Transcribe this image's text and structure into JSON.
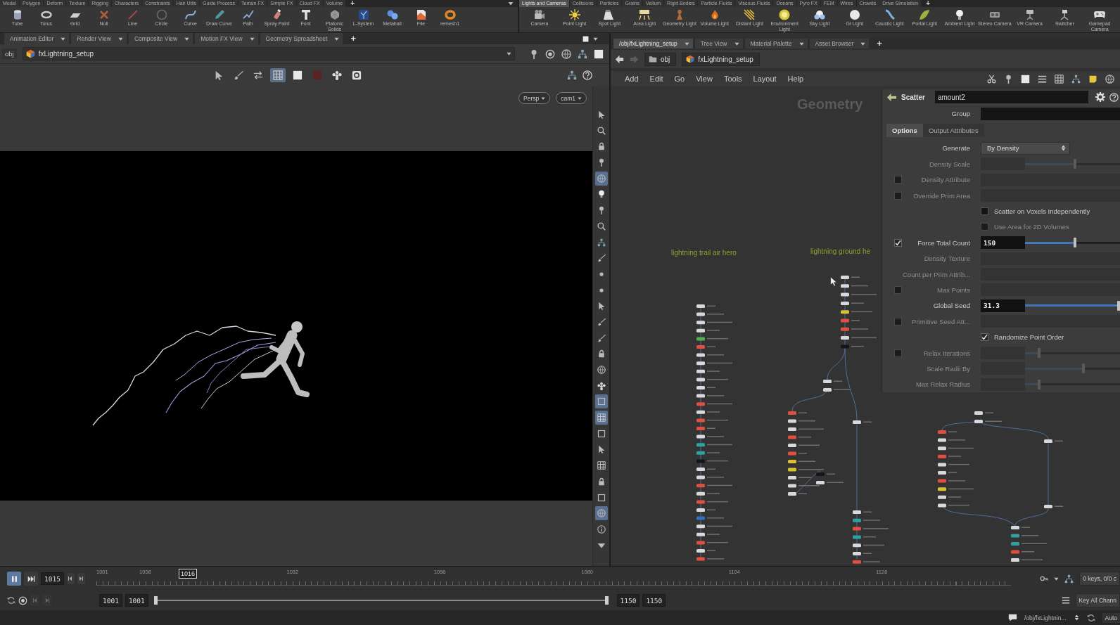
{
  "shelf": {
    "left": {
      "tabs": [
        {
          "label": "Model",
          "selected": false
        },
        {
          "label": "Polygon",
          "selected": false
        },
        {
          "label": "Deform",
          "selected": false
        },
        {
          "label": "Texture",
          "selected": false
        },
        {
          "label": "Rigging",
          "selected": false
        },
        {
          "label": "Characters",
          "selected": false
        },
        {
          "label": "Constraints",
          "selected": false
        },
        {
          "label": "Hair Utils",
          "selected": false
        },
        {
          "label": "Guide Process",
          "selected": false
        },
        {
          "label": "Terrain FX",
          "selected": false
        },
        {
          "label": "Simple FX",
          "selected": false
        },
        {
          "label": "Cloud FX",
          "selected": false
        },
        {
          "label": "Volume",
          "selected": false
        }
      ],
      "add": "+",
      "tools": [
        "Tube",
        "Torus",
        "Grid",
        "Null",
        "Line",
        "Circle",
        "Curve",
        "Draw Curve",
        "Path",
        "Spray Paint",
        "Font",
        "Platonic Solids",
        "L-System",
        "Metaball",
        "File",
        "remesh1"
      ]
    },
    "right": {
      "tabs": [
        {
          "label": "Lights and Cameras",
          "selected": true
        },
        {
          "label": "Collisions",
          "selected": false
        },
        {
          "label": "Particles",
          "selected": false
        },
        {
          "label": "Grains",
          "selected": false
        },
        {
          "label": "Vellum",
          "selected": false
        },
        {
          "label": "Rigid Bodies",
          "selected": false
        },
        {
          "label": "Particle Fluids",
          "selected": false
        },
        {
          "label": "Viscous Fluids",
          "selected": false
        },
        {
          "label": "Oceans",
          "selected": false
        },
        {
          "label": "Pyro FX",
          "selected": false
        },
        {
          "label": "FEM",
          "selected": false
        },
        {
          "label": "Wires",
          "selected": false
        },
        {
          "label": "Crowds",
          "selected": false
        },
        {
          "label": "Drive Simulation",
          "selected": false
        }
      ],
      "add": "+",
      "tools": [
        "Camera",
        "Point Light",
        "Spot Light",
        "Area Light",
        "Geometry Light",
        "Volume Light",
        "Distant Light",
        "Environment Light",
        "Sky Light",
        "GI Light",
        "Caustic Light",
        "Portal Light",
        "Ambient Light",
        "Stereo Camera",
        "VR Camera",
        "Switcher",
        "Gamepad Camera"
      ]
    }
  },
  "scene_view": {
    "tabs": [
      {
        "label": "Animation Editor",
        "selected": false
      },
      {
        "label": "Render View",
        "selected": false
      },
      {
        "label": "Composite View",
        "selected": false
      },
      {
        "label": "Motion FX View",
        "selected": false
      },
      {
        "label": "Geometry Spreadsheet",
        "selected": false
      }
    ],
    "add": "+",
    "path": {
      "context": "obj",
      "node": "fxLightning_setup"
    },
    "toolbar": [
      {
        "selected": false
      },
      {
        "selected": false
      },
      {
        "selected": false
      },
      {
        "selected": true
      },
      {
        "selected": false
      },
      {
        "selected": false
      },
      {
        "selected": false
      },
      {
        "selected": false
      }
    ],
    "camera_menus": [
      "Persp",
      "cam1"
    ],
    "side_toolbar": [
      {
        "selected": false
      },
      {
        "selected": false
      },
      {
        "selected": false
      },
      {
        "selected": false
      },
      {
        "selected": true
      },
      {
        "selected": false
      },
      {
        "selected": false
      },
      {
        "selected": false
      },
      {
        "selected": false
      },
      {
        "selected": false
      },
      {
        "selected": false
      },
      {
        "selected": false
      },
      {
        "selected": false
      },
      {
        "selected": false
      },
      {
        "selected": false
      },
      {
        "selected": false
      },
      {
        "selected": false
      },
      {
        "selected": false
      },
      {
        "selected": true
      },
      {
        "selected": true
      },
      {
        "selected": false
      },
      {
        "selected": false
      },
      {
        "selected": false
      },
      {
        "selected": false
      },
      {
        "selected": false
      },
      {
        "selected": true
      },
      {
        "selected": false
      },
      {
        "selected": false
      }
    ]
  },
  "network_view": {
    "tabs": [
      {
        "label": "/obj/fxLightning_setup",
        "selected": true
      },
      {
        "label": "Tree View",
        "selected": false
      },
      {
        "label": "Material Palette",
        "selected": false
      },
      {
        "label": "Asset Browser",
        "selected": false
      }
    ],
    "add": "+",
    "path": {
      "context": "obj",
      "node": "fxLightning_setup"
    },
    "menu": [
      "Add",
      "Edit",
      "Go",
      "View",
      "Tools",
      "Layout",
      "Help"
    ],
    "context_label": "Geometry",
    "sticky_notes": [
      "lightning trail air hero",
      "lightning ground he"
    ]
  },
  "parameters": {
    "node_type": "Scatter",
    "node_name": "amount2",
    "group_label": "Group",
    "tabs": [
      {
        "label": "Options",
        "selected": true
      },
      {
        "label": "Output Attributes",
        "selected": false
      }
    ],
    "rows": [
      {
        "kind": "menu",
        "label": "Generate",
        "value": "By Density",
        "disabled": false
      },
      {
        "kind": "slider",
        "label": "Density Scale",
        "disabled": true,
        "level": 0.53
      },
      {
        "kind": "field",
        "label": "Density Attribute",
        "disabled": true,
        "checked": false
      },
      {
        "kind": "field",
        "label": "Override Prim Area",
        "disabled": true,
        "checked": false
      },
      {
        "kind": "toggle",
        "label": "Scatter on Voxels Independently",
        "disabled": false,
        "checked": false
      },
      {
        "kind": "toggle",
        "label": "Use Area for 2D Volumes",
        "disabled": true,
        "checked": false
      },
      {
        "kind": "slider",
        "label": "Force Total Count",
        "value": "150",
        "disabled": false,
        "checked": true,
        "level": 0.53
      },
      {
        "kind": "field",
        "label": "Density Texture",
        "disabled": true
      },
      {
        "kind": "field",
        "label": "Count per Prim Attrib...",
        "disabled": true
      },
      {
        "kind": "field",
        "label": "Max Points",
        "disabled": true,
        "checked": false
      },
      {
        "kind": "slider",
        "label": "Global Seed",
        "value": "31.3",
        "disabled": false,
        "level": 1
      },
      {
        "kind": "field",
        "label": "Primitive Seed Att...",
        "disabled": true,
        "checked": false
      },
      {
        "kind": "toggle",
        "label": "Randomize Point Order",
        "disabled": false,
        "checked": true
      },
      {
        "kind": "slider",
        "label": "Relax Iterations",
        "disabled": true,
        "checked": false,
        "level": 0.14
      },
      {
        "kind": "slider",
        "label": "Scale Radii By",
        "disabled": true,
        "level": 0.62
      },
      {
        "kind": "slider",
        "label": "Max Relax Radius",
        "disabled": true,
        "level": 0.14
      }
    ]
  },
  "timeline": {
    "playing": true,
    "frame": "1015",
    "ticks": [
      "1001",
      "1008",
      "1032",
      "1056",
      "1080",
      "1104",
      "1128"
    ],
    "marker": "1016",
    "level": 0.1,
    "range_start": [
      "1001",
      "1001"
    ],
    "range": {
      "level": 1
    },
    "range_end": [
      "1150",
      "1150"
    ],
    "keys_label": "0 keys, 0/0 c",
    "key_all": "Key All Chann"
  },
  "status_bar": {
    "path": "/obj/fxLightnin...",
    "mode": "Auto"
  }
}
